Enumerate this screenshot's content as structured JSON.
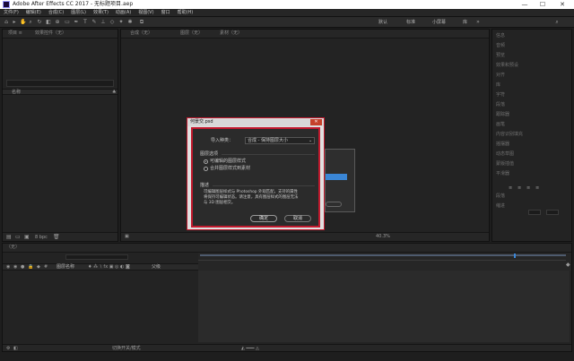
{
  "window": {
    "title": "Adobe After Effects CC 2017 - 无标题项目.aep",
    "minimize": "—",
    "maximize": "☐",
    "close": "✕"
  },
  "menu": [
    "文件(F)",
    "编辑(E)",
    "合成(C)",
    "图层(L)",
    "效果(T)",
    "动画(A)",
    "视图(V)",
    "窗口",
    "帮助(H)"
  ],
  "workspaces": [
    "默认",
    "标准",
    "小屏幕",
    "库"
  ],
  "project_panel": {
    "tab_label": "项目 ≡",
    "effects_tab": "效果控件（无）",
    "column_header": "名称",
    "footer_bpc": "8 bpc"
  },
  "composition_panel": {
    "tab_label": "合成（无）",
    "layer_tab": "图层（无）",
    "footage_tab": "素材（无）",
    "zoom": "40.3%"
  },
  "right_panel": {
    "items": [
      "信息",
      "音频",
      "预览",
      "效果和预设",
      "对齐",
      "库",
      "字符",
      "段落",
      "跟踪器",
      "画笔",
      "内容识别填充",
      "摇摆器",
      "动态草图",
      "蒙版插值",
      "平滑器"
    ],
    "section_label": "段落",
    "indent_label": "缩进"
  },
  "timeline": {
    "tab_label": "（无）",
    "header_name": "图层名称",
    "header_parent": "父级",
    "toggle_label": "切换开关/模式"
  },
  "dialog": {
    "title": "何景交.psd",
    "import_kind_label": "导入种类：",
    "import_kind_value": "合成 - 保持图层大小",
    "layer_options_label": "图层选项",
    "option_editable": "可编辑的图层样式",
    "option_merge": "合并图层样式到素材",
    "description_label": "描述",
    "description_text": [
      "可编辑图层样式与 Photoshop 外观匹配，支持的属性",
      "将保持可编辑状态。请注意，具有图层样式的图层无法",
      "与 3D 图层相交。"
    ],
    "ok_button": "确定",
    "cancel_button": "取消"
  },
  "colors": {
    "accent_red": "#c21a2e",
    "progress_blue": "#3a86d6"
  }
}
